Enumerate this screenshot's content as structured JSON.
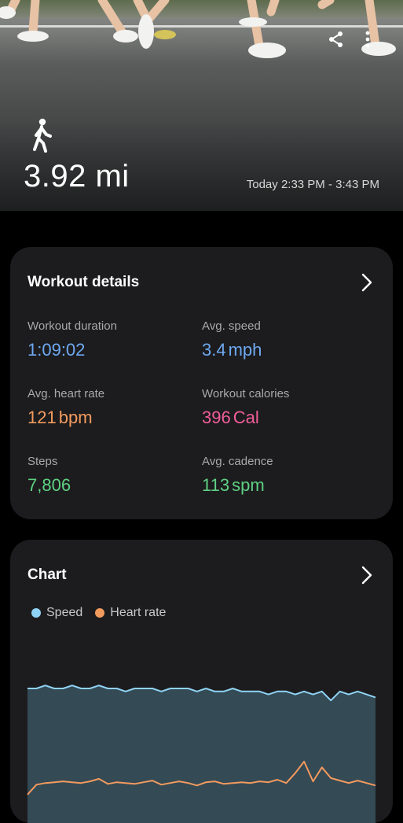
{
  "hero": {
    "distance": "3.92 mi",
    "time_range": "Today 2:33 PM - 3:43 PM",
    "activity_icon": "walking-icon",
    "share_icon": "share-icon",
    "more_icon": "more-vertical-icon"
  },
  "details": {
    "title": "Workout details",
    "duration": {
      "label": "Workout duration",
      "value": "1:09:02"
    },
    "speed": {
      "label": "Avg. speed",
      "value": "3.4",
      "unit": "mph"
    },
    "heart_rate": {
      "label": "Avg. heart rate",
      "value": "121",
      "unit": "bpm"
    },
    "calories": {
      "label": "Workout calories",
      "value": "396",
      "unit": "Cal"
    },
    "steps": {
      "label": "Steps",
      "value": "7,806"
    },
    "cadence": {
      "label": "Avg. cadence",
      "value": "113",
      "unit": "spm"
    }
  },
  "chart_card": {
    "title": "Chart",
    "legend": [
      "Speed",
      "Heart rate"
    ],
    "colors": {
      "speed": "#8fd3f4",
      "heart_rate": "#f39a5e",
      "speed_fill": "#344a55"
    }
  },
  "chart_data": {
    "type": "area",
    "series": [
      {
        "name": "Speed",
        "values": [
          3.5,
          3.5,
          3.6,
          3.5,
          3.5,
          3.6,
          3.5,
          3.5,
          3.6,
          3.5,
          3.5,
          3.4,
          3.5,
          3.5,
          3.5,
          3.4,
          3.5,
          3.5,
          3.5,
          3.4,
          3.5,
          3.4,
          3.4,
          3.5,
          3.4,
          3.4,
          3.4,
          3.3,
          3.4,
          3.4,
          3.3,
          3.4,
          3.3,
          3.4,
          3.1,
          3.4,
          3.3,
          3.4,
          3.3,
          3.2
        ]
      },
      {
        "name": "Heart rate",
        "values": [
          102,
          114,
          116,
          117,
          118,
          117,
          116,
          118,
          121,
          115,
          117,
          116,
          115,
          117,
          119,
          114,
          116,
          118,
          116,
          113,
          117,
          118,
          115,
          116,
          117,
          116,
          118,
          117,
          120,
          116,
          128,
          142,
          118,
          135,
          122,
          119,
          116,
          119,
          116,
          113
        ]
      }
    ]
  }
}
